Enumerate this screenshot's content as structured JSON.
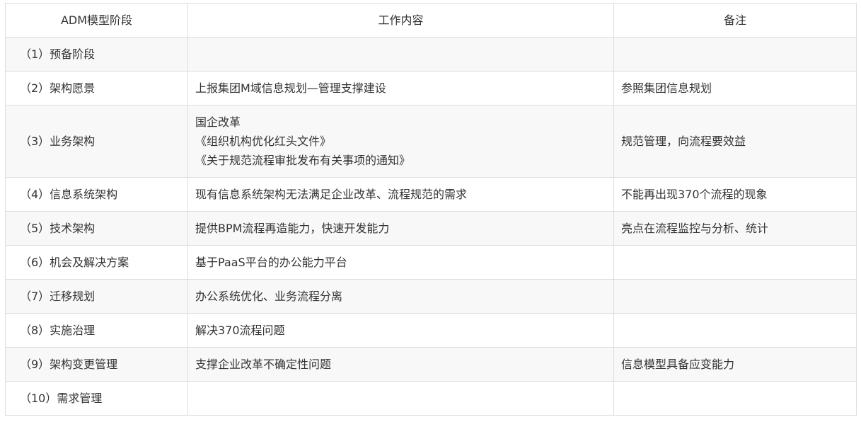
{
  "table": {
    "headers": [
      "ADM模型阶段",
      "工作内容",
      "备注"
    ],
    "rows": [
      {
        "stage": "（1）预备阶段",
        "work": [
          ""
        ],
        "note": ""
      },
      {
        "stage": "（2）架构愿景",
        "work": [
          "上报集团M域信息规划—管理支撑建设"
        ],
        "note": "参照集团信息规划"
      },
      {
        "stage": "（3）业务架构",
        "work": [
          "国企改革",
          "《组织机构优化红头文件》",
          "《关于规范流程审批发布有关事项的通知》"
        ],
        "note": "规范管理，向流程要效益"
      },
      {
        "stage": "（4）信息系统架构",
        "work": [
          "现有信息系统架构无法满足企业改革、流程规范的需求"
        ],
        "note": "不能再出现370个流程的现象"
      },
      {
        "stage": "（5）技术架构",
        "work": [
          "提供BPM流程再造能力，快速开发能力"
        ],
        "note": "亮点在流程监控与分析、统计"
      },
      {
        "stage": "（6）机会及解决方案",
        "work": [
          "基于PaaS平台的办公能力平台"
        ],
        "note": ""
      },
      {
        "stage": "（7）迁移规划",
        "work": [
          "办公系统优化、业务流程分离"
        ],
        "note": ""
      },
      {
        "stage": "（8）实施治理",
        "work": [
          "解决370流程问题"
        ],
        "note": ""
      },
      {
        "stage": "（9）架构变更管理",
        "work": [
          "支撑企业改革不确定性问题"
        ],
        "note": "信息模型具备应变能力"
      },
      {
        "stage": "（10）需求管理",
        "work": [
          ""
        ],
        "note": ""
      }
    ]
  }
}
